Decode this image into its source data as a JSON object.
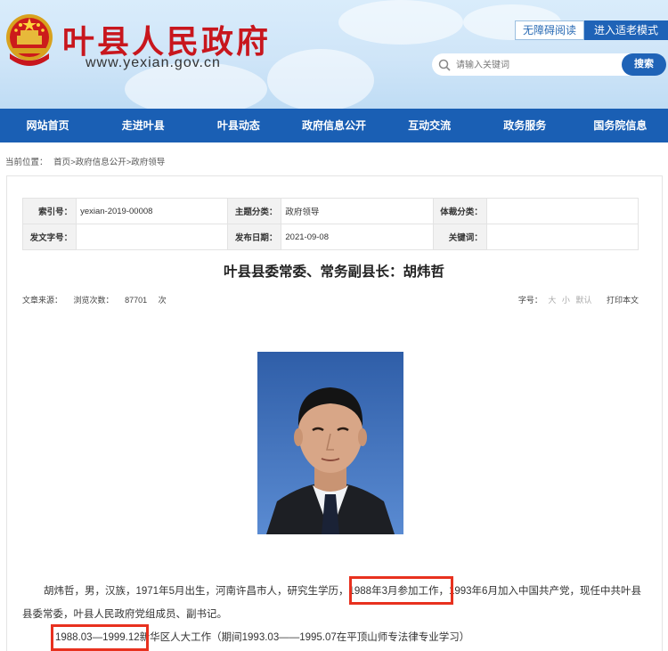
{
  "header": {
    "site_title": "叶县人民政府",
    "site_domain": "www.yexian.gov.cn",
    "accessibility_label": "无障碍阅读",
    "elder_mode_label": "进入适老模式",
    "search_placeholder": "请输入关键词",
    "search_button": "搜索"
  },
  "nav": {
    "items": [
      "网站首页",
      "走进叶县",
      "叶县动态",
      "政府信息公开",
      "互动交流",
      "政务服务",
      "国务院信息"
    ]
  },
  "breadcrumb": {
    "label": "当前位置：",
    "path": "首页>政府信息公开>政府领导"
  },
  "info": {
    "index_label": "索引号：",
    "index_value": "yexian-2019-00008",
    "topic_label": "主题分类：",
    "topic_value": "政府领导",
    "genre_label": "体裁分类：",
    "genre_value": "",
    "doc_no_label": "发文字号：",
    "doc_no_value": "",
    "date_label": "发布日期：",
    "date_value": "2021-09-08",
    "keyword_label": "关键词：",
    "keyword_value": ""
  },
  "article": {
    "title": "叶县县委常委、常务副县长：胡炜哲",
    "source_label": "文章来源：",
    "views_label": "浏览次数：",
    "views_value": "87701",
    "views_unit": "次",
    "font_label": "字号：",
    "font_large": "大",
    "font_small": "小",
    "font_default": "默认",
    "print_label": "打印本文",
    "para1_a": "胡炜哲，男，汉族，1971年5月出生，河南许昌市人，研究生学历，",
    "para1_hl": "1988年3月参加工作",
    "para1_b": "，1993年6月加入中国共产党，现任中共叶县县委常委，叶县人民政府党组成员、副书记。",
    "para2_hl": "1988.03—1999.12",
    "para2_b": "新华区人大工作（期间1993.03——1995.07在平顶山师专法律专业学习）"
  },
  "colors": {
    "brand_red": "#c8161d",
    "nav_blue": "#1a5fb4",
    "highlight_red": "#e8311f"
  }
}
